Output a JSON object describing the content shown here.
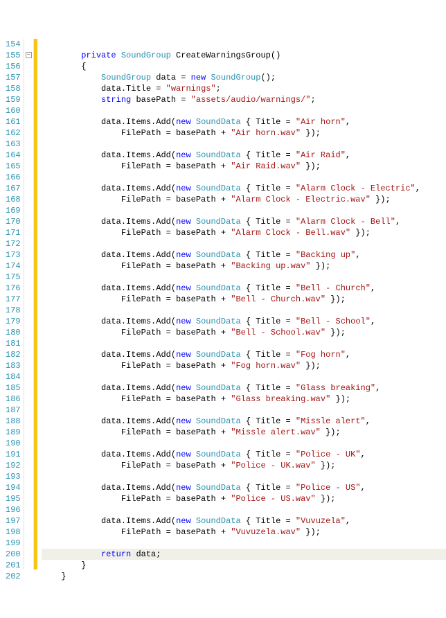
{
  "startLine": 154,
  "endLine": 202,
  "foldLine": 155,
  "highlightedLine": 200,
  "lines": [
    {
      "ln": 154,
      "tokens": []
    },
    {
      "ln": 155,
      "indent": "        ",
      "tokens": [
        {
          "t": "kw",
          "v": "private"
        },
        {
          "t": "plain",
          "v": " "
        },
        {
          "t": "type",
          "v": "SoundGroup"
        },
        {
          "t": "plain",
          "v": " CreateWarningsGroup()"
        }
      ]
    },
    {
      "ln": 156,
      "indent": "        ",
      "tokens": [
        {
          "t": "plain",
          "v": "{"
        }
      ]
    },
    {
      "ln": 157,
      "indent": "            ",
      "tokens": [
        {
          "t": "type",
          "v": "SoundGroup"
        },
        {
          "t": "plain",
          "v": " data = "
        },
        {
          "t": "kw",
          "v": "new"
        },
        {
          "t": "plain",
          "v": " "
        },
        {
          "t": "type",
          "v": "SoundGroup"
        },
        {
          "t": "plain",
          "v": "();"
        }
      ]
    },
    {
      "ln": 158,
      "indent": "            ",
      "tokens": [
        {
          "t": "plain",
          "v": "data.Title = "
        },
        {
          "t": "str",
          "v": "\"warnings\""
        },
        {
          "t": "plain",
          "v": ";"
        }
      ]
    },
    {
      "ln": 159,
      "indent": "            ",
      "tokens": [
        {
          "t": "kw",
          "v": "string"
        },
        {
          "t": "plain",
          "v": " basePath = "
        },
        {
          "t": "str",
          "v": "\"assets/audio/warnings/\""
        },
        {
          "t": "plain",
          "v": ";"
        }
      ]
    },
    {
      "ln": 160,
      "tokens": []
    },
    {
      "ln": 161,
      "indent": "            ",
      "tokens": [
        {
          "t": "plain",
          "v": "data.Items.Add("
        },
        {
          "t": "kw",
          "v": "new"
        },
        {
          "t": "plain",
          "v": " "
        },
        {
          "t": "type",
          "v": "SoundData"
        },
        {
          "t": "plain",
          "v": " { Title = "
        },
        {
          "t": "str",
          "v": "\"Air horn\""
        },
        {
          "t": "plain",
          "v": ","
        }
      ]
    },
    {
      "ln": 162,
      "indent": "                ",
      "tokens": [
        {
          "t": "plain",
          "v": "FilePath = basePath + "
        },
        {
          "t": "str",
          "v": "\"Air horn.wav\""
        },
        {
          "t": "plain",
          "v": " });"
        }
      ]
    },
    {
      "ln": 163,
      "tokens": []
    },
    {
      "ln": 164,
      "indent": "            ",
      "tokens": [
        {
          "t": "plain",
          "v": "data.Items.Add("
        },
        {
          "t": "kw",
          "v": "new"
        },
        {
          "t": "plain",
          "v": " "
        },
        {
          "t": "type",
          "v": "SoundData"
        },
        {
          "t": "plain",
          "v": " { Title = "
        },
        {
          "t": "str",
          "v": "\"Air Raid\""
        },
        {
          "t": "plain",
          "v": ","
        }
      ]
    },
    {
      "ln": 165,
      "indent": "                ",
      "tokens": [
        {
          "t": "plain",
          "v": "FilePath = basePath + "
        },
        {
          "t": "str",
          "v": "\"Air Raid.wav\""
        },
        {
          "t": "plain",
          "v": " });"
        }
      ]
    },
    {
      "ln": 166,
      "tokens": []
    },
    {
      "ln": 167,
      "indent": "            ",
      "tokens": [
        {
          "t": "plain",
          "v": "data.Items.Add("
        },
        {
          "t": "kw",
          "v": "new"
        },
        {
          "t": "plain",
          "v": " "
        },
        {
          "t": "type",
          "v": "SoundData"
        },
        {
          "t": "plain",
          "v": " { Title = "
        },
        {
          "t": "str",
          "v": "\"Alarm Clock - Electric\""
        },
        {
          "t": "plain",
          "v": ","
        }
      ]
    },
    {
      "ln": 168,
      "indent": "                ",
      "tokens": [
        {
          "t": "plain",
          "v": "FilePath = basePath + "
        },
        {
          "t": "str",
          "v": "\"Alarm Clock - Electric.wav\""
        },
        {
          "t": "plain",
          "v": " });"
        }
      ]
    },
    {
      "ln": 169,
      "tokens": []
    },
    {
      "ln": 170,
      "indent": "            ",
      "tokens": [
        {
          "t": "plain",
          "v": "data.Items.Add("
        },
        {
          "t": "kw",
          "v": "new"
        },
        {
          "t": "plain",
          "v": " "
        },
        {
          "t": "type",
          "v": "SoundData"
        },
        {
          "t": "plain",
          "v": " { Title = "
        },
        {
          "t": "str",
          "v": "\"Alarm Clock - Bell\""
        },
        {
          "t": "plain",
          "v": ","
        }
      ]
    },
    {
      "ln": 171,
      "indent": "                ",
      "tokens": [
        {
          "t": "plain",
          "v": "FilePath = basePath + "
        },
        {
          "t": "str",
          "v": "\"Alarm Clock - Bell.wav\""
        },
        {
          "t": "plain",
          "v": " });"
        }
      ]
    },
    {
      "ln": 172,
      "tokens": []
    },
    {
      "ln": 173,
      "indent": "            ",
      "tokens": [
        {
          "t": "plain",
          "v": "data.Items.Add("
        },
        {
          "t": "kw",
          "v": "new"
        },
        {
          "t": "plain",
          "v": " "
        },
        {
          "t": "type",
          "v": "SoundData"
        },
        {
          "t": "plain",
          "v": " { Title = "
        },
        {
          "t": "str",
          "v": "\"Backing up\""
        },
        {
          "t": "plain",
          "v": ","
        }
      ]
    },
    {
      "ln": 174,
      "indent": "                ",
      "tokens": [
        {
          "t": "plain",
          "v": "FilePath = basePath + "
        },
        {
          "t": "str",
          "v": "\"Backing up.wav\""
        },
        {
          "t": "plain",
          "v": " });"
        }
      ]
    },
    {
      "ln": 175,
      "tokens": []
    },
    {
      "ln": 176,
      "indent": "            ",
      "tokens": [
        {
          "t": "plain",
          "v": "data.Items.Add("
        },
        {
          "t": "kw",
          "v": "new"
        },
        {
          "t": "plain",
          "v": " "
        },
        {
          "t": "type",
          "v": "SoundData"
        },
        {
          "t": "plain",
          "v": " { Title = "
        },
        {
          "t": "str",
          "v": "\"Bell - Church\""
        },
        {
          "t": "plain",
          "v": ","
        }
      ]
    },
    {
      "ln": 177,
      "indent": "                ",
      "tokens": [
        {
          "t": "plain",
          "v": "FilePath = basePath + "
        },
        {
          "t": "str",
          "v": "\"Bell - Church.wav\""
        },
        {
          "t": "plain",
          "v": " });"
        }
      ]
    },
    {
      "ln": 178,
      "tokens": []
    },
    {
      "ln": 179,
      "indent": "            ",
      "tokens": [
        {
          "t": "plain",
          "v": "data.Items.Add("
        },
        {
          "t": "kw",
          "v": "new"
        },
        {
          "t": "plain",
          "v": " "
        },
        {
          "t": "type",
          "v": "SoundData"
        },
        {
          "t": "plain",
          "v": " { Title = "
        },
        {
          "t": "str",
          "v": "\"Bell - School\""
        },
        {
          "t": "plain",
          "v": ","
        }
      ]
    },
    {
      "ln": 180,
      "indent": "                ",
      "tokens": [
        {
          "t": "plain",
          "v": "FilePath = basePath + "
        },
        {
          "t": "str",
          "v": "\"Bell - School.wav\""
        },
        {
          "t": "plain",
          "v": " });"
        }
      ]
    },
    {
      "ln": 181,
      "tokens": []
    },
    {
      "ln": 182,
      "indent": "            ",
      "tokens": [
        {
          "t": "plain",
          "v": "data.Items.Add("
        },
        {
          "t": "kw",
          "v": "new"
        },
        {
          "t": "plain",
          "v": " "
        },
        {
          "t": "type",
          "v": "SoundData"
        },
        {
          "t": "plain",
          "v": " { Title = "
        },
        {
          "t": "str",
          "v": "\"Fog horn\""
        },
        {
          "t": "plain",
          "v": ","
        }
      ]
    },
    {
      "ln": 183,
      "indent": "                ",
      "tokens": [
        {
          "t": "plain",
          "v": "FilePath = basePath + "
        },
        {
          "t": "str",
          "v": "\"Fog horn.wav\""
        },
        {
          "t": "plain",
          "v": " });"
        }
      ]
    },
    {
      "ln": 184,
      "tokens": []
    },
    {
      "ln": 185,
      "indent": "            ",
      "tokens": [
        {
          "t": "plain",
          "v": "data.Items.Add("
        },
        {
          "t": "kw",
          "v": "new"
        },
        {
          "t": "plain",
          "v": " "
        },
        {
          "t": "type",
          "v": "SoundData"
        },
        {
          "t": "plain",
          "v": " { Title = "
        },
        {
          "t": "str",
          "v": "\"Glass breaking\""
        },
        {
          "t": "plain",
          "v": ","
        }
      ]
    },
    {
      "ln": 186,
      "indent": "                ",
      "tokens": [
        {
          "t": "plain",
          "v": "FilePath = basePath + "
        },
        {
          "t": "str",
          "v": "\"Glass breaking.wav\""
        },
        {
          "t": "plain",
          "v": " });"
        }
      ]
    },
    {
      "ln": 187,
      "tokens": []
    },
    {
      "ln": 188,
      "indent": "            ",
      "tokens": [
        {
          "t": "plain",
          "v": "data.Items.Add("
        },
        {
          "t": "kw",
          "v": "new"
        },
        {
          "t": "plain",
          "v": " "
        },
        {
          "t": "type",
          "v": "SoundData"
        },
        {
          "t": "plain",
          "v": " { Title = "
        },
        {
          "t": "str",
          "v": "\"Missle alert\""
        },
        {
          "t": "plain",
          "v": ","
        }
      ]
    },
    {
      "ln": 189,
      "indent": "                ",
      "tokens": [
        {
          "t": "plain",
          "v": "FilePath = basePath + "
        },
        {
          "t": "str",
          "v": "\"Missle alert.wav\""
        },
        {
          "t": "plain",
          "v": " });"
        }
      ]
    },
    {
      "ln": 190,
      "tokens": []
    },
    {
      "ln": 191,
      "indent": "            ",
      "tokens": [
        {
          "t": "plain",
          "v": "data.Items.Add("
        },
        {
          "t": "kw",
          "v": "new"
        },
        {
          "t": "plain",
          "v": " "
        },
        {
          "t": "type",
          "v": "SoundData"
        },
        {
          "t": "plain",
          "v": " { Title = "
        },
        {
          "t": "str",
          "v": "\"Police - UK\""
        },
        {
          "t": "plain",
          "v": ","
        }
      ]
    },
    {
      "ln": 192,
      "indent": "                ",
      "tokens": [
        {
          "t": "plain",
          "v": "FilePath = basePath + "
        },
        {
          "t": "str",
          "v": "\"Police - UK.wav\""
        },
        {
          "t": "plain",
          "v": " });"
        }
      ]
    },
    {
      "ln": 193,
      "tokens": []
    },
    {
      "ln": 194,
      "indent": "            ",
      "tokens": [
        {
          "t": "plain",
          "v": "data.Items.Add("
        },
        {
          "t": "kw",
          "v": "new"
        },
        {
          "t": "plain",
          "v": " "
        },
        {
          "t": "type",
          "v": "SoundData"
        },
        {
          "t": "plain",
          "v": " { Title = "
        },
        {
          "t": "str",
          "v": "\"Police - US\""
        },
        {
          "t": "plain",
          "v": ","
        }
      ]
    },
    {
      "ln": 195,
      "indent": "                ",
      "tokens": [
        {
          "t": "plain",
          "v": "FilePath = basePath + "
        },
        {
          "t": "str",
          "v": "\"Police - US.wav\""
        },
        {
          "t": "plain",
          "v": " });"
        }
      ]
    },
    {
      "ln": 196,
      "tokens": []
    },
    {
      "ln": 197,
      "indent": "            ",
      "tokens": [
        {
          "t": "plain",
          "v": "data.Items.Add("
        },
        {
          "t": "kw",
          "v": "new"
        },
        {
          "t": "plain",
          "v": " "
        },
        {
          "t": "type",
          "v": "SoundData"
        },
        {
          "t": "plain",
          "v": " { Title = "
        },
        {
          "t": "str",
          "v": "\"Vuvuzela\""
        },
        {
          "t": "plain",
          "v": ","
        }
      ]
    },
    {
      "ln": 198,
      "indent": "                ",
      "tokens": [
        {
          "t": "plain",
          "v": "FilePath = basePath + "
        },
        {
          "t": "str",
          "v": "\"Vuvuzela.wav\""
        },
        {
          "t": "plain",
          "v": " });"
        }
      ]
    },
    {
      "ln": 199,
      "tokens": []
    },
    {
      "ln": 200,
      "indent": "            ",
      "tokens": [
        {
          "t": "kw",
          "v": "return"
        },
        {
          "t": "plain",
          "v": " data;"
        }
      ]
    },
    {
      "ln": 201,
      "indent": "        ",
      "tokens": [
        {
          "t": "plain",
          "v": "}"
        }
      ]
    },
    {
      "ln": 202,
      "indent": "    ",
      "tokens": [
        {
          "t": "plain",
          "v": "}"
        }
      ]
    }
  ]
}
